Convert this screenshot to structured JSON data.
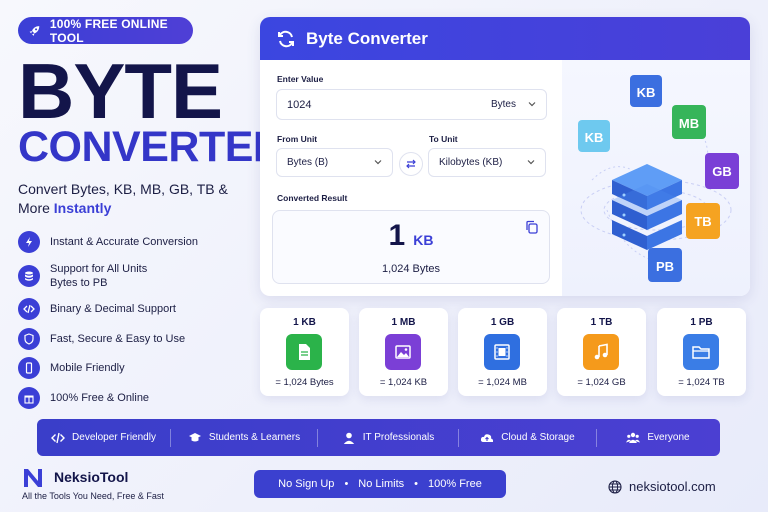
{
  "badge": {
    "label": "100% FREE ONLINE TOOL",
    "icon": "rocket-icon"
  },
  "hero": {
    "title": "BYTE",
    "subtitle": "CONVERTER",
    "tagline_plain": "Convert Bytes, KB, MB, GB, TB & More ",
    "tagline_accent": "Instantly"
  },
  "features": [
    {
      "icon": "bolt-icon",
      "label": "Instant & Accurate Conversion"
    },
    {
      "icon": "database-icon",
      "label": "Support for All Units",
      "label2": "Bytes to PB"
    },
    {
      "icon": "code-icon",
      "label": "Binary & Decimal Support"
    },
    {
      "icon": "shield-icon",
      "label": "Fast, Secure & Easy to Use"
    },
    {
      "icon": "mobile-icon",
      "label": "Mobile Friendly"
    },
    {
      "icon": "gift-icon",
      "label": "100% Free & Online"
    }
  ],
  "converter": {
    "title": "Byte Converter",
    "enter_value_label": "Enter Value",
    "value": "1024",
    "value_unit": "Bytes",
    "from_label": "From Unit",
    "from_value": "Bytes (B)",
    "to_label": "To Unit",
    "to_value": "Kilobytes (KB)",
    "result_label": "Converted Result",
    "result_number": "1",
    "result_unit": "KB",
    "result_sub": "1,024 Bytes"
  },
  "illustration_labels": [
    "KB",
    "MB",
    "GB",
    "TB",
    "PB",
    "KB"
  ],
  "tiles": [
    {
      "title": "1 KB",
      "value": "= 1,024 Bytes",
      "icon": "document-icon",
      "color": "#2bb34a"
    },
    {
      "title": "1 MB",
      "value": "= 1,024 KB",
      "icon": "image-icon",
      "color": "#7b3fd6"
    },
    {
      "title": "1 GB",
      "value": "= 1,024 MB",
      "icon": "film-icon",
      "color": "#2f6fe0"
    },
    {
      "title": "1 TB",
      "value": "= 1,024 GB",
      "icon": "music-icon",
      "color": "#f59a1b"
    },
    {
      "title": "1 PB",
      "value": "= 1,024 TB",
      "icon": "folder-icon",
      "color": "#3a7de6"
    }
  ],
  "audience": [
    {
      "icon": "code-icon",
      "label": "Developer Friendly"
    },
    {
      "icon": "graduation-cap-icon",
      "label": "Students & Learners"
    },
    {
      "icon": "user-icon",
      "label": "IT Professionals"
    },
    {
      "icon": "cloud-upload-icon",
      "label": "Cloud & Storage"
    },
    {
      "icon": "users-icon",
      "label": "Everyone"
    }
  ],
  "footer": {
    "brand": "NeksioTool",
    "tagline": "All the Tools You Need, Free & Fast",
    "pill": [
      "No Sign Up",
      "No Limits",
      "100% Free"
    ],
    "website": "neksiotool.com"
  },
  "colors": {
    "primary": "#3b3fd6",
    "navy": "#13154a"
  }
}
